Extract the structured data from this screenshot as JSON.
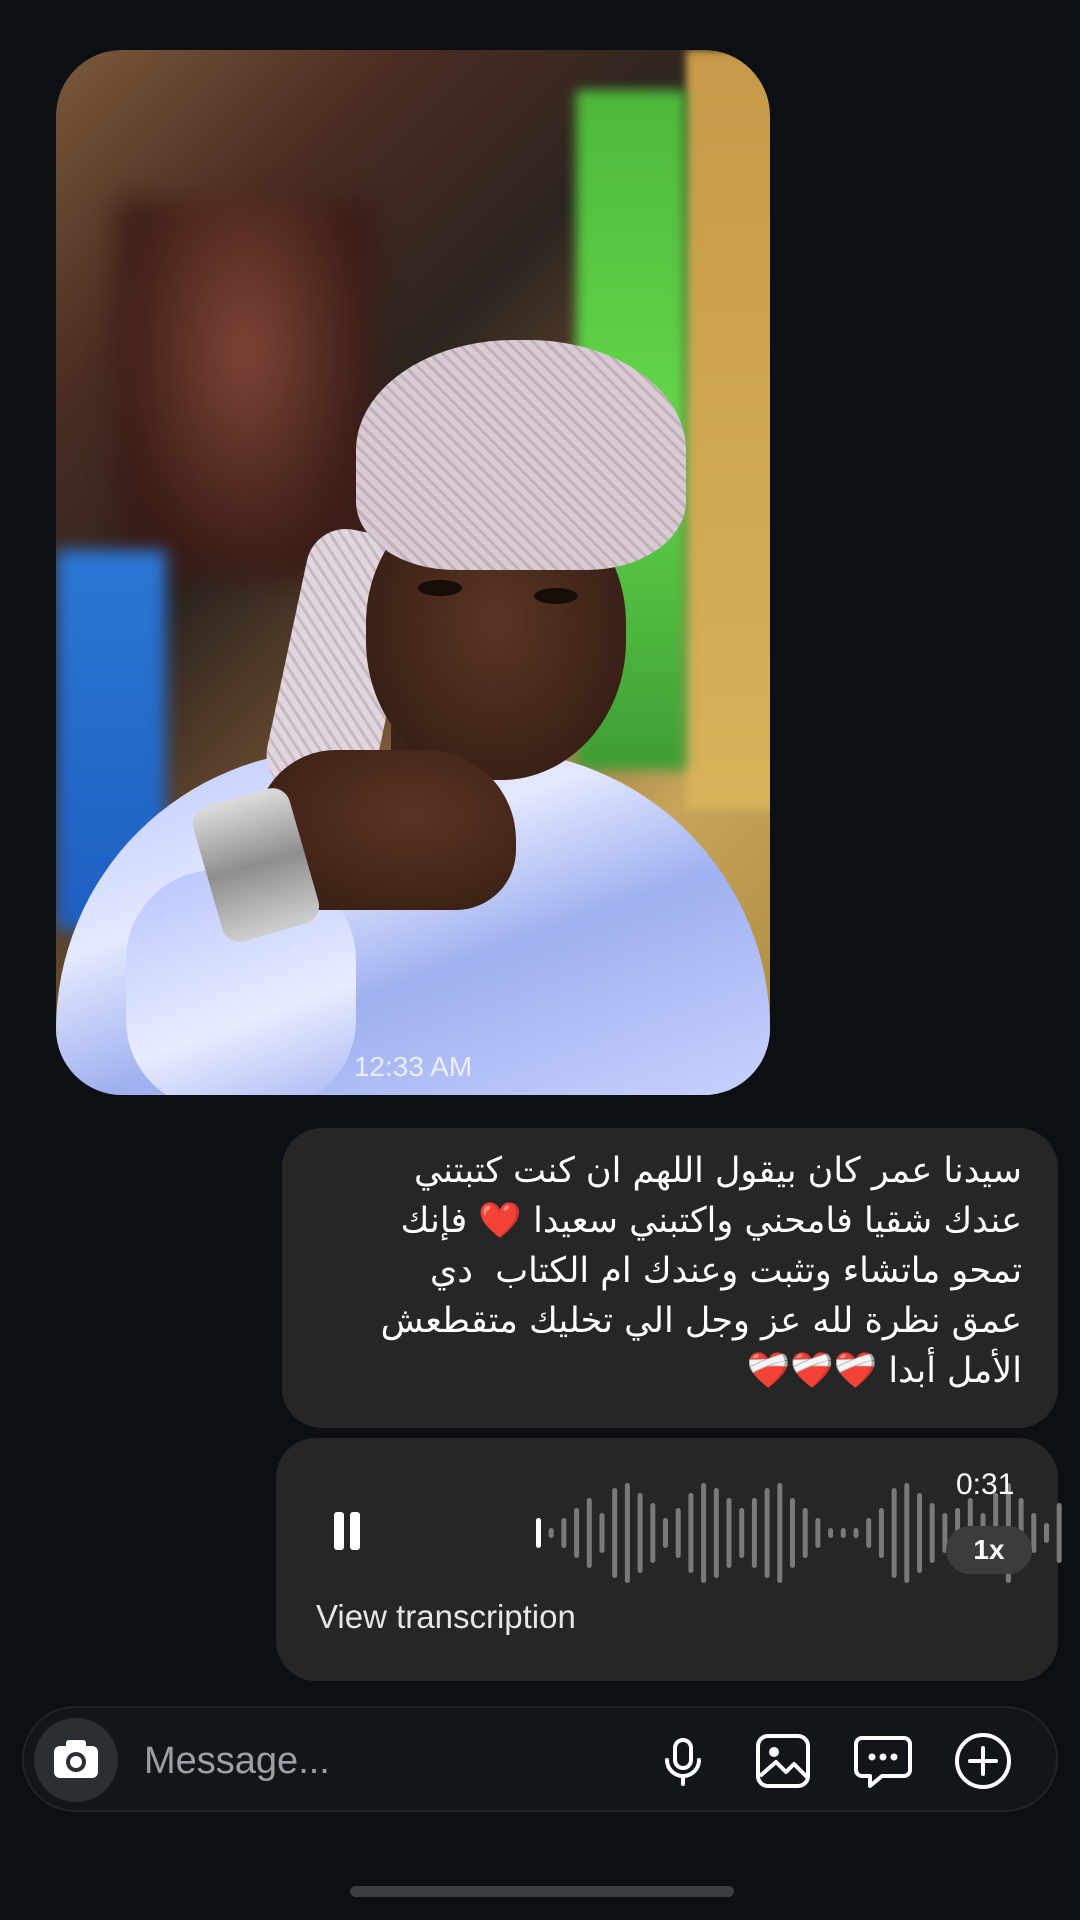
{
  "conversation": {
    "photo_message": {
      "timestamp": "12:33 AM"
    },
    "text_message": {
      "lines": [
        "سيدنا عمر كان بيقول اللهم ان كنت كتبتني",
        "عندك شقيا فامحني واكتبني سعيدا ❤️ فإنك",
        "تمحو ماتشاء وتثبت وعندك ام الكتاب  دي",
        "عمق نظرة لله عز وجل الي تخليك متقطعش",
        "الأمل أبدا ❤️‍🩹❤️‍🩹❤️‍🩹"
      ]
    },
    "voice_message": {
      "duration": "0:31",
      "speed": "1x",
      "transcription_link": "View transcription",
      "waveform_levels": [
        0.3,
        0.1,
        0.3,
        0.5,
        0.7,
        0.4,
        0.9,
        1.0,
        0.8,
        0.6,
        0.3,
        0.5,
        0.8,
        1.0,
        0.9,
        0.7,
        0.5,
        0.7,
        0.9,
        1.0,
        0.7,
        0.5,
        0.3,
        0.1,
        0.1,
        0.1,
        0.3,
        0.5,
        0.9,
        1.0,
        0.8,
        0.6,
        0.4,
        0.5,
        0.7,
        0.4,
        0.8,
        1.0,
        0.7,
        0.4,
        0.2,
        0.6
      ]
    }
  },
  "composer": {
    "placeholder": "Message...",
    "icons": [
      "camera-icon",
      "microphone-icon",
      "gallery-icon",
      "chat-bubble-icon",
      "plus-icon"
    ]
  },
  "colors": {
    "background": "#0c1015",
    "bubble": "#262626",
    "heart": "#e0202f"
  }
}
